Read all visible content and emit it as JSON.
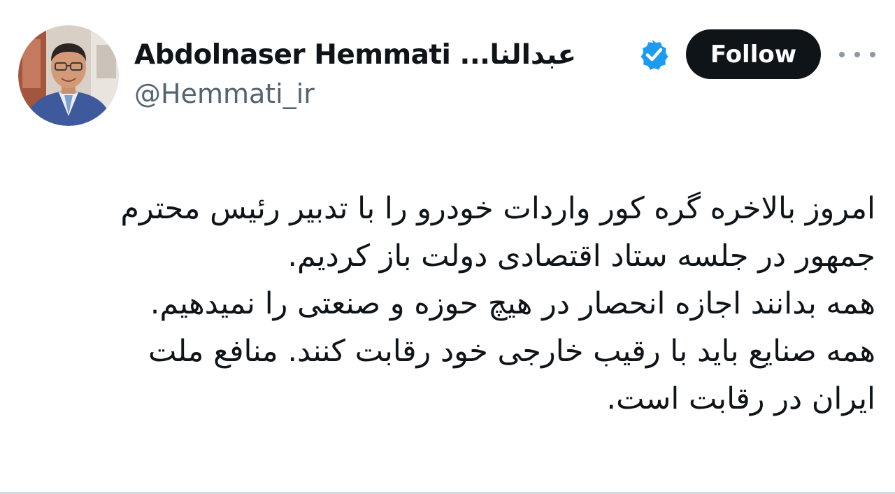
{
  "author": {
    "display_name": "Abdolnaser Hemmati ...عبدالنا",
    "handle": "@Hemmati_ir",
    "verified": true,
    "verified_icon": "verified-badge-icon",
    "avatar_icon": "profile-photo"
  },
  "actions": {
    "follow_label": "Follow",
    "more_icon": "more-options-icon"
  },
  "tweet": {
    "lines": [
      "امروز بالاخره گره کور واردات خودرو را با تدبیر رئیس محترم",
      "جمهور در جلسه ستاد اقتصادی دولت باز کردیم.",
      "همه بدانند اجازه انحصار در هیچ حوزه و صنعتی را نمیدهیم.",
      "همه صنایع باید با رقیب خارجی خود رقابت کنند. منافع ملت",
      "ایران در رقابت است."
    ]
  },
  "colors": {
    "text": "#0f1419",
    "secondary_text": "#536471",
    "follow_bg": "#0f1419",
    "verified": "#1d9bf0"
  }
}
